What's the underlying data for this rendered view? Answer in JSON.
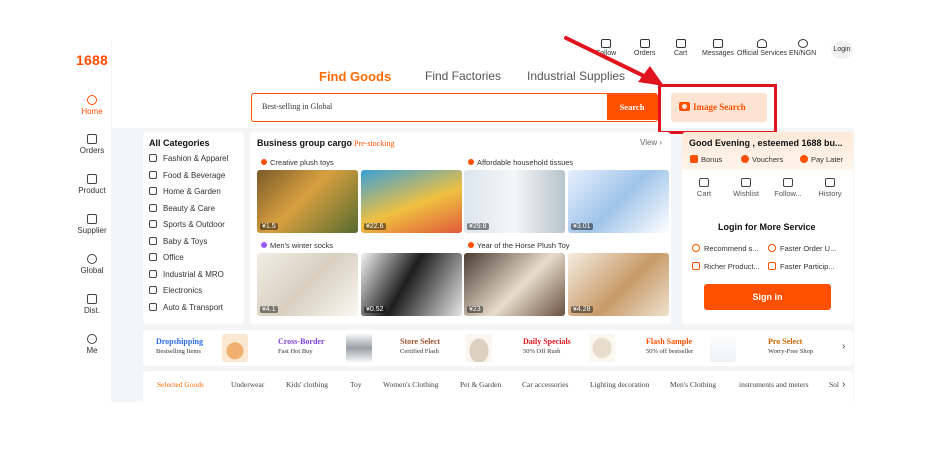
{
  "logo": "1688",
  "nav": [
    {
      "label": "Home",
      "icon": "home-icon",
      "active": true
    },
    {
      "label": "Orders",
      "icon": "orders-icon"
    },
    {
      "label": "Product",
      "icon": "grid-icon"
    },
    {
      "label": "Supplier",
      "icon": "supplier-icon"
    },
    {
      "label": "Global",
      "icon": "globe-icon"
    },
    {
      "label": "Dist.",
      "icon": "distribution-icon"
    },
    {
      "label": "Me",
      "icon": "me-icon"
    }
  ],
  "topbar": [
    {
      "label": "Follow",
      "icon": "follow-icon"
    },
    {
      "label": "Orders",
      "icon": "orders-icon"
    },
    {
      "label": "Cart",
      "icon": "cart-icon"
    },
    {
      "label": "Messages",
      "icon": "message-icon"
    },
    {
      "label": "Official Services",
      "icon": "person-icon"
    },
    {
      "label": "EN/NGN",
      "icon": "globe-icon"
    }
  ],
  "login": "Login",
  "tabs": [
    "Find Goods",
    "Find Factories",
    "Industrial Supplies"
  ],
  "search": {
    "query": "Best-selling in Global",
    "button": "Search"
  },
  "image_search": "Image Search",
  "categories": {
    "title": "All Categories",
    "items": [
      "Fashion & Apparel",
      "Food & Beverage",
      "Home & Garden",
      "Beauty & Care",
      "Sports & Outdoor",
      "Baby & Toys",
      "Office",
      "Industrial & MRO",
      "Electronics",
      "Auto & Transport"
    ]
  },
  "business": {
    "title": "Business group cargo",
    "subtitle": "Pre-stocking",
    "view": "View",
    "groups": [
      {
        "label": "Creative plush toys",
        "prices": [
          "¥1.5",
          "¥22.6"
        ]
      },
      {
        "label": "Affordable household tissues",
        "prices": [
          "¥29.8",
          "¥3.01"
        ]
      },
      {
        "label": "Men's winter socks",
        "prices": [
          "¥4.1",
          "¥0.52"
        ]
      },
      {
        "label": "Year of the Horse Plush Toy",
        "prices": [
          "¥23",
          "¥4.28"
        ]
      }
    ]
  },
  "account": {
    "greeting": "Good Evening , esteemed 1688 bu...",
    "perks": [
      "Bonus",
      "Vouchers",
      "Pay Later"
    ],
    "quick": [
      "Cart",
      "Wishlist",
      "Follow...",
      "History"
    ],
    "login_title": "Login for More Service",
    "services": [
      "Recommend s...",
      "Faster Order U...",
      "Richer Product...",
      "Faster Particip..."
    ],
    "signin": "Sign in"
  },
  "promos": [
    {
      "title": "Dropshipping",
      "sub": "Bestselling Items",
      "color": "#2d6cdf"
    },
    {
      "title": "Cross-Border",
      "sub": "Fast Hot Buy",
      "color": "#7b3fd6"
    },
    {
      "title": "Store Select",
      "sub": "Certified Flash",
      "color": "#a0522d"
    },
    {
      "title": "Daily Specials",
      "sub": "50% Off Rush",
      "color": "#e0141e"
    },
    {
      "title": "Flash Sample",
      "sub": "50% off bestseller",
      "color": "#ff5000"
    },
    {
      "title": "Pro Select",
      "sub": "Worry-Free Shop",
      "color": "#c86400"
    }
  ],
  "category_tabs": [
    "Selected Goods",
    "Underwear",
    "Kids' clothing",
    "Toy",
    "Women's Clothing",
    "Pet & Garden",
    "Car accessories",
    "Lighting decoration",
    "Men's Clothing",
    "instruments and meters",
    "Sol"
  ],
  "colors": {
    "accent": "#ff5000",
    "highlight_box": "#e0141e"
  }
}
